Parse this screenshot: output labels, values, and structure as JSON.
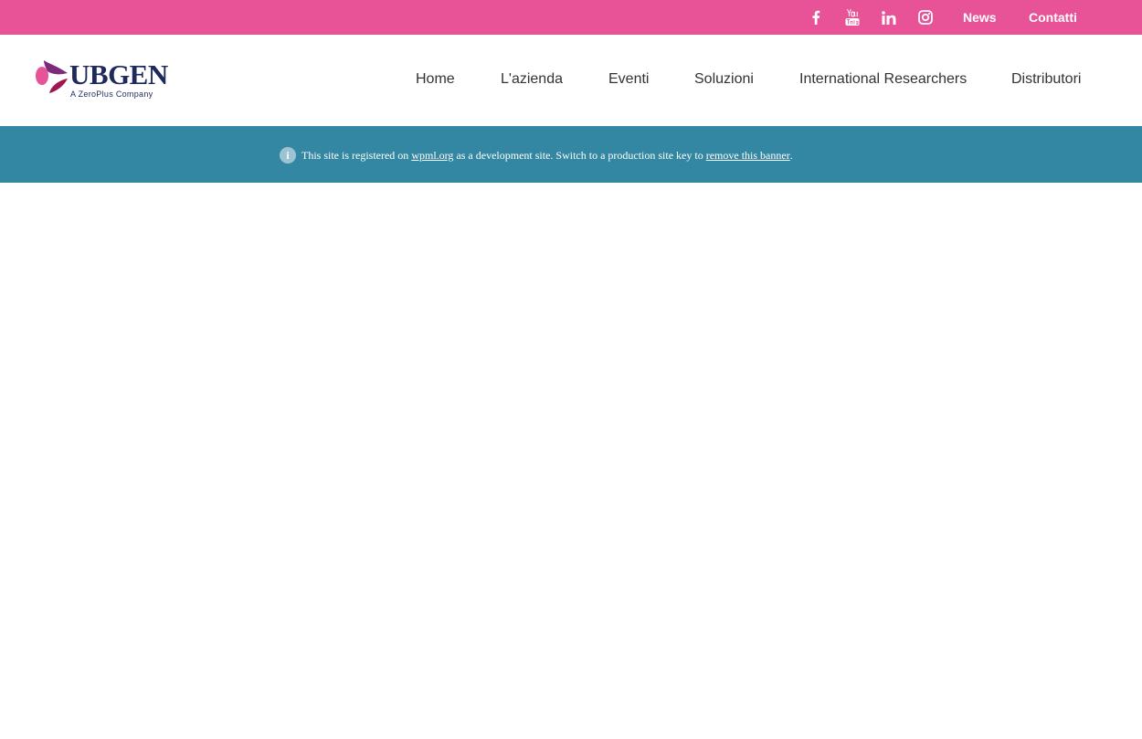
{
  "topbar": {
    "social": [
      {
        "name": "facebook-icon"
      },
      {
        "name": "youtube-icon"
      },
      {
        "name": "linkedin-icon"
      },
      {
        "name": "instagram-icon"
      }
    ],
    "links": {
      "news": "News",
      "contatti": "Contatti"
    },
    "color": "#e85398"
  },
  "logo": {
    "name": "UBGEN",
    "tagline": "A ZeroPlus Company"
  },
  "nav": {
    "home": "Home",
    "azienda": "L'azienda",
    "eventi": "Eventi",
    "soluzioni": "Soluzioni",
    "researchers": "International Researchers",
    "distributori": "Distributori"
  },
  "banner": {
    "color": "#3387a2",
    "icon": "info-icon",
    "text_before": "This site is registered on",
    "link1": "wpml.org",
    "text_middle": "as a development site. Switch to a production site key to",
    "link2": "remove this banner",
    "text_end": "."
  }
}
